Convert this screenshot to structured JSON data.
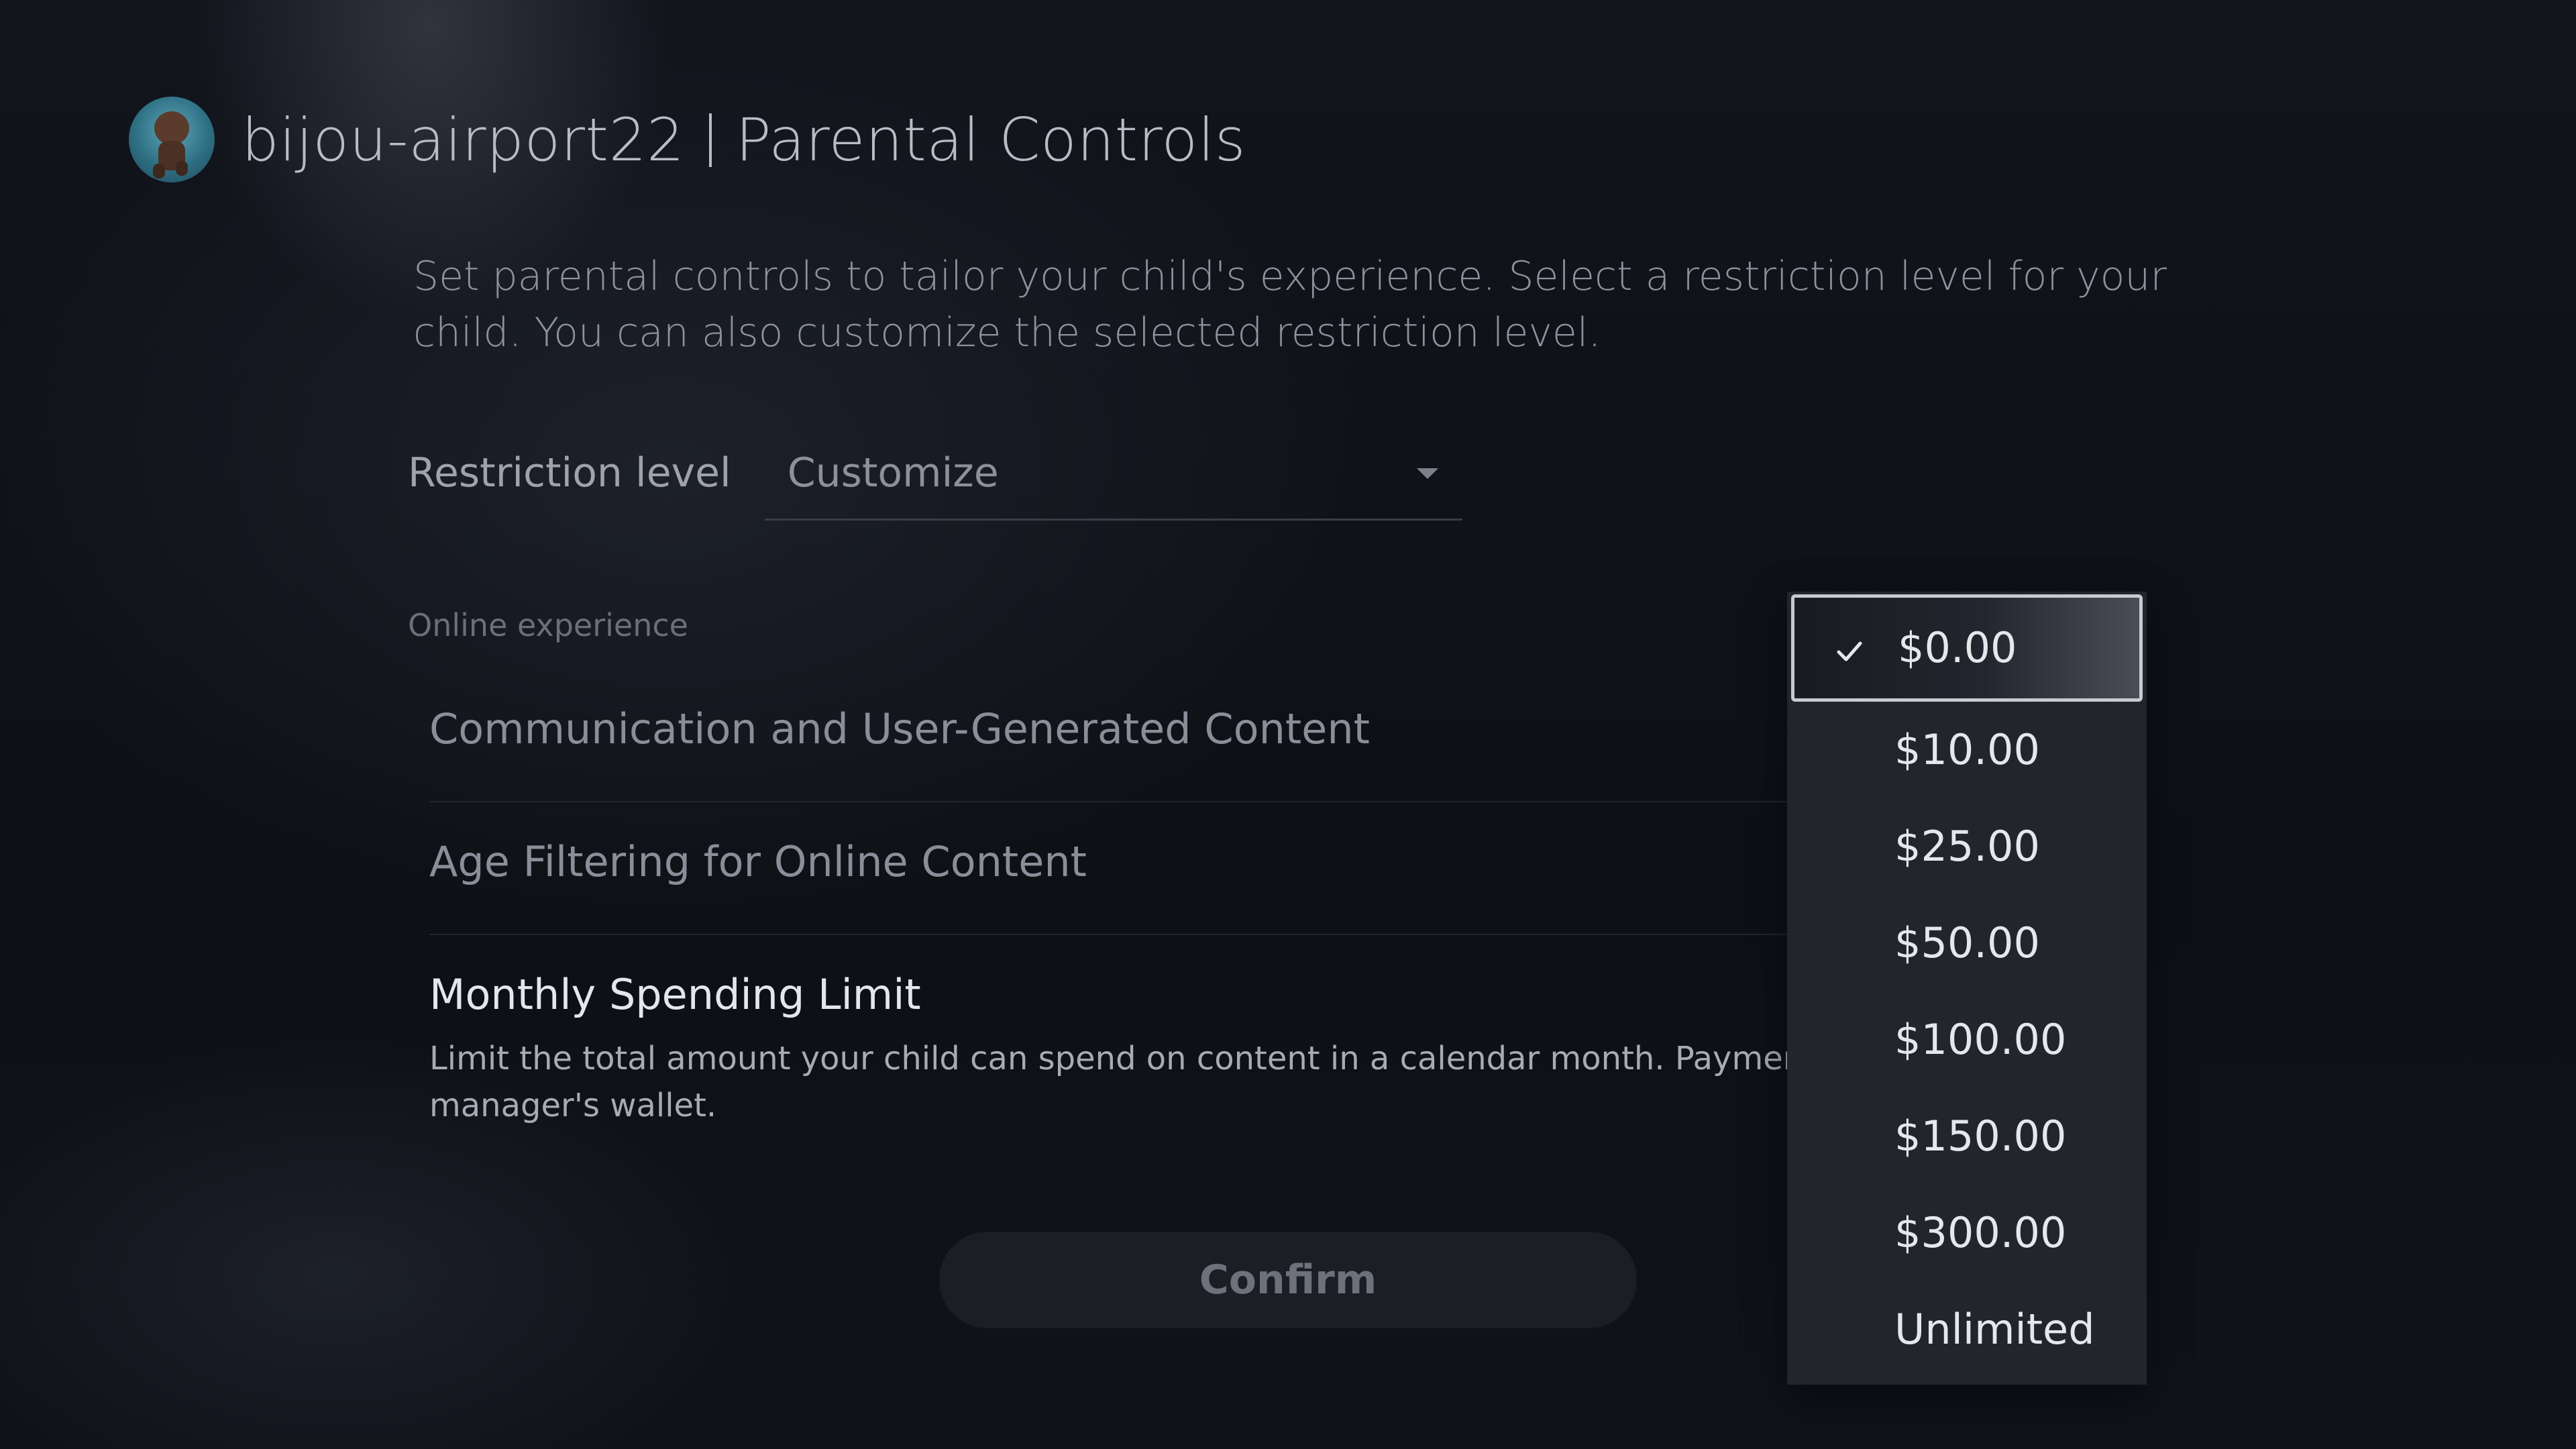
{
  "header": {
    "username": "bijou-airport22",
    "page_title": "Parental Controls"
  },
  "description": "Set parental controls to tailor your child's experience. Select a restriction level for your child. You can also customize the selected restriction level.",
  "restriction": {
    "label": "Restriction level",
    "value": "Customize"
  },
  "section": {
    "title": "Online experience"
  },
  "settings": [
    {
      "title": "Communication and User-Generated Content"
    },
    {
      "title": "Age Filtering for Online Content"
    },
    {
      "title": "Monthly Spending Limit",
      "description_line1": "Limit the total amount your child can spend on content in a calendar month. Payments are ma",
      "description_line2": "manager's wallet."
    }
  ],
  "confirm_label": "Confirm",
  "dropdown": {
    "selected": "$0.00",
    "options": [
      "$0.00",
      "$10.00",
      "$25.00",
      "$50.00",
      "$100.00",
      "$150.00",
      "$300.00",
      "Unlimited"
    ]
  },
  "icons": {
    "check": "check-icon",
    "caret": "chevron-down-icon"
  }
}
